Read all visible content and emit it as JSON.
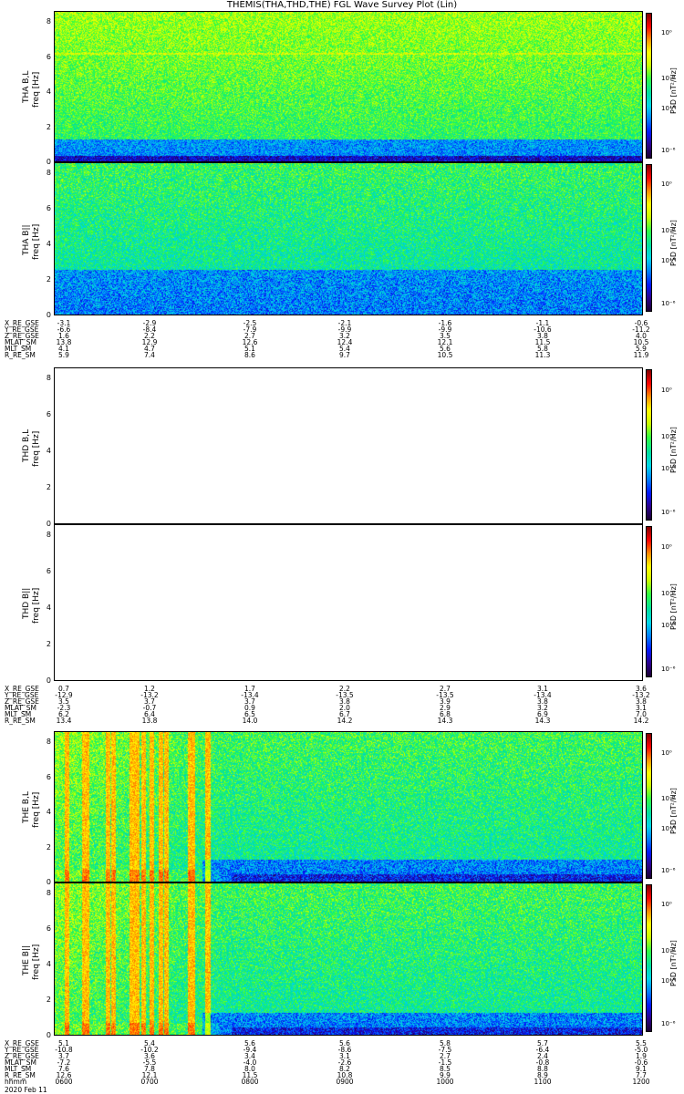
{
  "title": "THEMIS(THA,THD,THE) FGL Wave Survey Plot (Lin)",
  "colors": {
    "colormap": [
      "#1a0030",
      "#2a008f",
      "#0018ff",
      "#0080ff",
      "#00d8e8",
      "#00e0a0",
      "#30ff40",
      "#c8ff00",
      "#ffff00",
      "#ff9000",
      "#ff0000",
      "#800000"
    ]
  },
  "chart_data": [
    {
      "type": "heatmap",
      "ylabel": [
        "THA B,L",
        "freq [Hz]"
      ],
      "yticks": [
        "0",
        "2",
        "4",
        "6",
        "8"
      ],
      "ylim": [
        0,
        8
      ],
      "colorbar_label": "PSD [nT²/Hz]",
      "colorbar_ticks": [
        "10⁰",
        "10⁻³",
        "10⁻⁴",
        "10⁻⁶"
      ],
      "activity": "moderate"
    },
    {
      "type": "heatmap",
      "ylabel": [
        "THA B||",
        "freq [Hz]"
      ],
      "yticks": [
        "0",
        "2",
        "4",
        "6",
        "8"
      ],
      "ylim": [
        0,
        8
      ],
      "colorbar_label": "PSD [nT²/Hz]",
      "colorbar_ticks": [
        "10⁰",
        "10⁻³",
        "10⁻⁴",
        "10⁻⁶"
      ],
      "activity": "low"
    },
    {
      "type": "heatmap",
      "ylabel": [
        "THD B,L",
        "freq [Hz]"
      ],
      "yticks": [
        "0",
        "2",
        "4",
        "6",
        "8"
      ],
      "ylim": [
        0,
        8
      ],
      "colorbar_label": "PSD [nT²/Hz]",
      "colorbar_ticks": [
        "10⁰",
        "10⁻³",
        "10⁻⁴",
        "10⁻⁶"
      ],
      "activity": "none"
    },
    {
      "type": "heatmap",
      "ylabel": [
        "THD B||",
        "freq [Hz]"
      ],
      "yticks": [
        "0",
        "2",
        "4",
        "6",
        "8"
      ],
      "ylim": [
        0,
        8
      ],
      "colorbar_label": "PSD [nT²/Hz]",
      "colorbar_ticks": [
        "10⁰",
        "10⁻³",
        "10⁻⁴",
        "10⁻⁶"
      ],
      "activity": "none"
    },
    {
      "type": "heatmap",
      "ylabel": [
        "THE B,L",
        "freq [Hz]"
      ],
      "yticks": [
        "0",
        "2",
        "4",
        "6",
        "8"
      ],
      "ylim": [
        0,
        8
      ],
      "colorbar_label": "PSD [nT²/Hz]",
      "colorbar_ticks": [
        "10⁰",
        "10⁻³",
        "10⁻⁴",
        "10⁻⁶"
      ],
      "activity": "bursts"
    },
    {
      "type": "heatmap",
      "ylabel": [
        "THE B||",
        "freq [Hz]"
      ],
      "yticks": [
        "0",
        "2",
        "4",
        "6",
        "8"
      ],
      "ylim": [
        0,
        8
      ],
      "colorbar_label": "PSD [nT²/Hz]",
      "colorbar_ticks": [
        "10⁰",
        "10⁻³",
        "10⁻⁴",
        "10⁻⁶"
      ],
      "activity": "bursts"
    }
  ],
  "ephemeris": [
    {
      "names": [
        "X_RE_GSE",
        "Y_RE_GSE",
        "Z_RE_GSE",
        "MLAT_SM",
        "MLT_SM",
        "R_RE_SM"
      ],
      "columns": [
        [
          "-3.1",
          "-6.6",
          "1.6",
          "13.8",
          "4.1",
          "5.9"
        ],
        [
          "-2.9",
          "-8.4",
          "2.2",
          "12.9",
          "4.7",
          "7.4"
        ],
        [
          "-2.5",
          "-7.9",
          "2.7",
          "12.6",
          "5.1",
          "8.6"
        ],
        [
          "-2.1",
          "-9.9",
          "3.2",
          "12.4",
          "5.4",
          "9.7"
        ],
        [
          "-1.6",
          "-9.9",
          "3.5",
          "12.1",
          "5.6",
          "10.5"
        ],
        [
          "-1.1",
          "-10.6",
          "3.8",
          "11.5",
          "5.8",
          "11.3"
        ],
        [
          "-0.6",
          "-11.2",
          "4.0",
          "10.5",
          "5.9",
          "11.9"
        ]
      ]
    },
    {
      "names": [
        "X_RE_GSE",
        "Y_RE_GSE",
        "Z_RE_GSE",
        "MLAT_SM",
        "MLT_SM",
        "R_RE_SM"
      ],
      "columns": [
        [
          "0.7",
          "-12.9",
          "3.5",
          "-2.3",
          "6.2",
          "13.4"
        ],
        [
          "1.2",
          "-13.2",
          "3.7",
          "-0.7",
          "6.4",
          "13.8"
        ],
        [
          "1.7",
          "-13.4",
          "3.7",
          "0.9",
          "6.5",
          "14.0"
        ],
        [
          "2.2",
          "-13.5",
          "3.8",
          "2.0",
          "6.7",
          "14.2"
        ],
        [
          "2.7",
          "-13.5",
          "3.9",
          "2.9",
          "6.8",
          "14.3"
        ],
        [
          "3.1",
          "-13.4",
          "3.8",
          "3.2",
          "6.9",
          "14.3"
        ],
        [
          "3.6",
          "-13.2",
          "3.8",
          "3.1",
          "7.0",
          "14.2"
        ]
      ]
    },
    {
      "names": [
        "X_RE_GSE",
        "Y_RE_GSE",
        "Z_RE_GSE",
        "MLAT_SM",
        "MLT_SM",
        "R_RE_SM",
        "hhmm"
      ],
      "columns": [
        [
          "5.1",
          "-10.8",
          "3.7",
          "-7.2",
          "7.6",
          "12.6",
          "0600"
        ],
        [
          "5.4",
          "-10.2",
          "3.6",
          "-5.5",
          "7.8",
          "12.1",
          "0700"
        ],
        [
          "5.6",
          "-9.4",
          "3.4",
          "-4.0",
          "8.0",
          "11.5",
          "0800"
        ],
        [
          "5.6",
          "-8.6",
          "3.1",
          "-2.6",
          "8.2",
          "10.8",
          "0900"
        ],
        [
          "5.8",
          "-7.5",
          "2.7",
          "-1.5",
          "8.5",
          "9.9",
          "1000"
        ],
        [
          "5.7",
          "-6.4",
          "2.4",
          "-0.8",
          "8.8",
          "8.9",
          "1100"
        ],
        [
          "5.5",
          "-5.0",
          "1.9",
          "-0.6",
          "9.1",
          "7.7",
          "1200"
        ]
      ]
    }
  ],
  "date_label": "2020 Feb 11"
}
